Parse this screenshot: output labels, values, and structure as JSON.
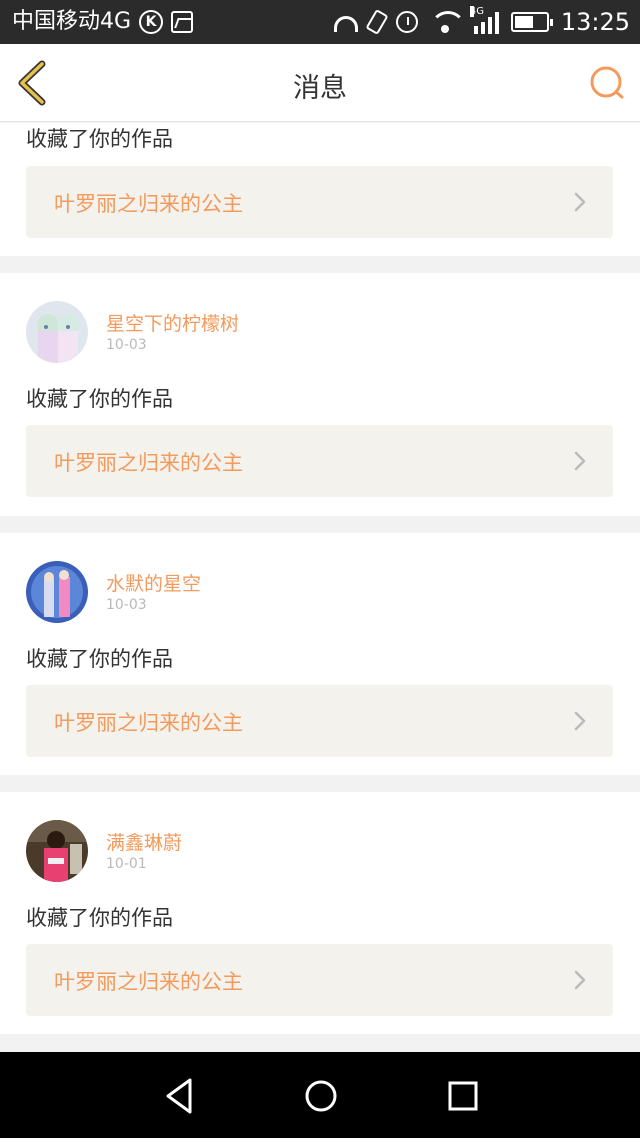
{
  "status_bar": {
    "carrier": "中国移动4G",
    "k_badge": "K",
    "network": "4G",
    "time": "13:25",
    "battery_level": 0.6,
    "icons": [
      "k-circle-icon",
      "image-icon",
      "headphone-icon",
      "vibrate-icon",
      "alarm-icon",
      "wifi-icon",
      "signal-icon",
      "battery-icon"
    ]
  },
  "header": {
    "title": "消息",
    "back_icon": "chevron-left-icon",
    "search_icon": "search-icon",
    "accent_color": "#f39a5c",
    "back_color": "#e8c14a"
  },
  "messages": [
    {
      "action": "收藏了你的作品",
      "work_title": "叶罗丽之归来的公主"
    },
    {
      "user": "星空下的柠檬树",
      "date": "10-03",
      "action": "收藏了你的作品",
      "work_title": "叶罗丽之归来的公主"
    },
    {
      "user": "水默的星空",
      "date": "10-03",
      "action": "收藏了你的作品",
      "work_title": "叶罗丽之归来的公主"
    },
    {
      "user": "满鑫琳蔚",
      "date": "10-01",
      "action": "收藏了你的作品",
      "work_title": "叶罗丽之归来的公主"
    }
  ],
  "nav": {
    "icons": [
      "back-triangle-icon",
      "home-circle-icon",
      "recents-square-icon"
    ]
  }
}
